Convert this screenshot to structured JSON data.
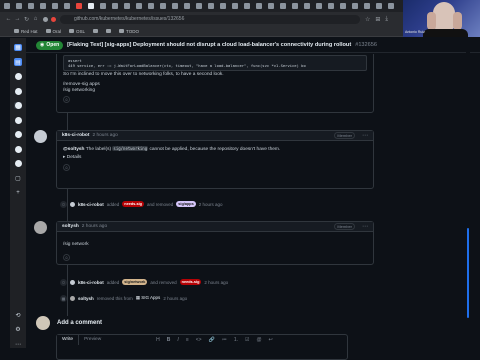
{
  "browser": {
    "url": "github.com/kubernetes/kubernetes/issues/132656",
    "bookmarks": [
      "Red Hat",
      "Oral",
      "OSL",
      "",
      "",
      "TODO"
    ]
  },
  "webcam": {
    "name": "Antonio Ruiz"
  },
  "issue": {
    "state": "Open",
    "title": "[Flaking Test] [sig-apps] Deployment should not disrupt a cloud load-balancer's connectivity during rollout",
    "number": "#132656"
  },
  "comment0": {
    "code_lines": [
      "assert",
      "449     service, err := j.WaitForLoadBalancer(ctx, timeout, \"have a load-balancer\", func(svc *v1.Service) bo"
    ],
    "text1": "So I'm inclined to move this over to networking folks, to have a second look.",
    "text2": "/remove-sig apps",
    "text3": "/sig networking"
  },
  "comment1": {
    "author": "k8s-ci-robot",
    "time": "2 hours ago",
    "role": "Member",
    "mention": "@soltysh",
    "text_a": "The label(s)",
    "label": "sig/networking",
    "text_b": "cannot be applied, because the repository doesn't have them.",
    "details": "Details"
  },
  "event1": {
    "actor": "k8s-ci-robot",
    "added": "added",
    "label_added": "needs-sig",
    "and_removed": "and removed",
    "label_removed": "sig/apps",
    "time": "2 hours ago"
  },
  "comment2": {
    "author": "soltysh",
    "time": "2 hours ago",
    "role": "Member",
    "text": "/sig network"
  },
  "event2": {
    "actor": "k8s-ci-robot",
    "added": "added",
    "label_added": "sig/network",
    "and_removed": "and removed",
    "label_removed": "needs-sig",
    "time": "2 hours ago"
  },
  "event3": {
    "actor": "soltysh",
    "text": "removed this from",
    "project": "SIG Apps",
    "time": "2 hours ago"
  },
  "add_comment": {
    "title": "Add a comment",
    "tab_write": "Write",
    "tab_preview": "Preview",
    "tools": [
      "H",
      "B",
      "I",
      "≡",
      "<>",
      "🔗",
      "≔",
      "1.",
      "☑",
      "@",
      "↩"
    ]
  },
  "colors": {
    "open_green": "#238636",
    "label_needs_sig": "#b60205",
    "label_sig_apps": "#d4c5f9",
    "label_sig_network": "#d2b48c",
    "accent_blue": "#1f6feb"
  }
}
